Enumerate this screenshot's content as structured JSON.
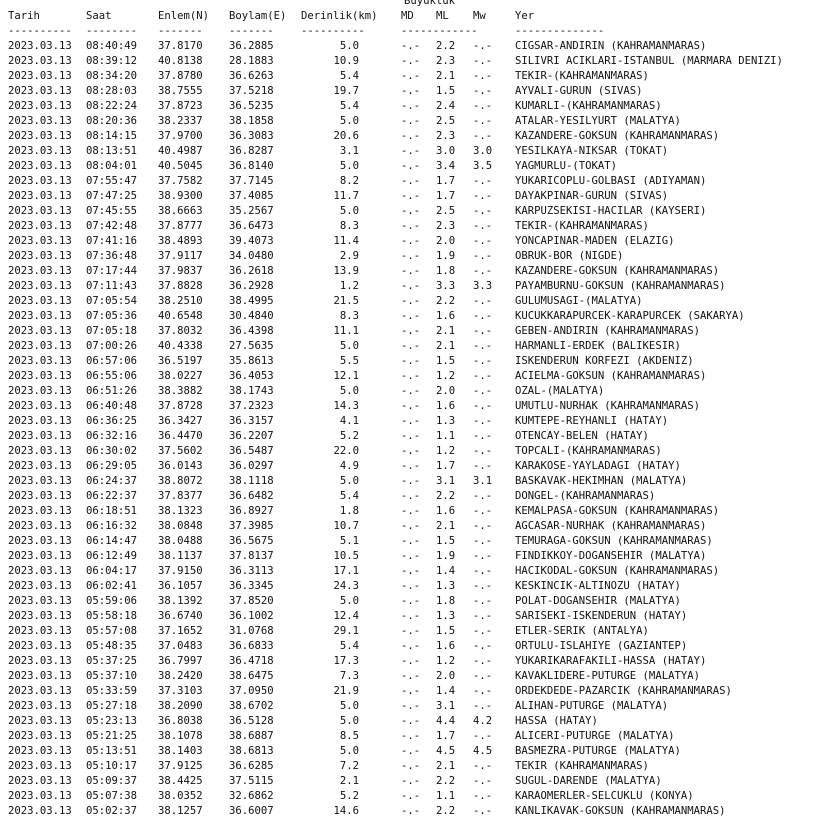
{
  "header": {
    "magnitude_group": "Buyukluk",
    "date": "Tarih",
    "time": "Saat",
    "lat": "Enlem(N)",
    "lon": "Boylam(E)",
    "depth": "Derinlik(km)",
    "md": "MD",
    "ml": "ML",
    "mw": "Mw",
    "place": "Yer"
  },
  "separators": {
    "date": "----------",
    "time": "--------",
    "lat": "-------",
    "lon": "-------",
    "depth": "----------",
    "mag": "------------",
    "place": "--------------"
  },
  "rows": [
    [
      "2023.03.13",
      "08:40:49",
      "37.8170",
      "36.2885",
      "5.0",
      "-.-",
      "2.2",
      "-.-",
      "CIGSAR-ANDIRIN (KAHRAMANMARAS)"
    ],
    [
      "2023.03.13",
      "08:39:12",
      "40.8138",
      "28.1883",
      "10.9",
      "-.-",
      "2.3",
      "-.-",
      "SILIVRI ACIKLARI-ISTANBUL (MARMARA DENIZI)"
    ],
    [
      "2023.03.13",
      "08:34:20",
      "37.8780",
      "36.6263",
      "5.4",
      "-.-",
      "2.1",
      "-.-",
      "TEKIR-(KAHRAMANMARAS)"
    ],
    [
      "2023.03.13",
      "08:28:03",
      "38.7555",
      "37.5218",
      "19.7",
      "-.-",
      "1.5",
      "-.-",
      "AYVALI-GURUN (SIVAS)"
    ],
    [
      "2023.03.13",
      "08:22:24",
      "37.8723",
      "36.5235",
      "5.4",
      "-.-",
      "2.4",
      "-.-",
      "KUMARLI-(KAHRAMANMARAS)"
    ],
    [
      "2023.03.13",
      "08:20:36",
      "38.2337",
      "38.1858",
      "5.0",
      "-.-",
      "2.5",
      "-.-",
      "ATALAR-YESILYURT (MALATYA)"
    ],
    [
      "2023.03.13",
      "08:14:15",
      "37.9700",
      "36.3083",
      "20.6",
      "-.-",
      "2.3",
      "-.-",
      "KAZANDERE-GOKSUN (KAHRAMANMARAS)"
    ],
    [
      "2023.03.13",
      "08:13:51",
      "40.4987",
      "36.8287",
      "3.1",
      "-.-",
      "3.0",
      "3.0",
      "YESILKAYA-NIKSAR (TOKAT)"
    ],
    [
      "2023.03.13",
      "08:04:01",
      "40.5045",
      "36.8140",
      "5.0",
      "-.-",
      "3.4",
      "3.5",
      "YAGMURLU-(TOKAT)"
    ],
    [
      "2023.03.13",
      "07:55:47",
      "37.7582",
      "37.7145",
      "8.2",
      "-.-",
      "1.7",
      "-.-",
      "YUKARICOPLU-GOLBASI (ADIYAMAN)"
    ],
    [
      "2023.03.13",
      "07:47:25",
      "38.9300",
      "37.4085",
      "11.7",
      "-.-",
      "1.7",
      "-.-",
      "DAYAKPINAR-GURUN (SIVAS)"
    ],
    [
      "2023.03.13",
      "07:45:55",
      "38.6663",
      "35.2567",
      "5.0",
      "-.-",
      "2.5",
      "-.-",
      "KARPUZSEKISI-HACILAR (KAYSERI)"
    ],
    [
      "2023.03.13",
      "07:42:48",
      "37.8777",
      "36.6473",
      "8.3",
      "-.-",
      "2.3",
      "-.-",
      "TEKIR-(KAHRAMANMARAS)"
    ],
    [
      "2023.03.13",
      "07:41:16",
      "38.4893",
      "39.4073",
      "11.4",
      "-.-",
      "2.0",
      "-.-",
      "YONCAPINAR-MADEN (ELAZIG)"
    ],
    [
      "2023.03.13",
      "07:36:48",
      "37.9117",
      "34.0480",
      "2.9",
      "-.-",
      "1.9",
      "-.-",
      "OBRUK-BOR (NIGDE)"
    ],
    [
      "2023.03.13",
      "07:17:44",
      "37.9837",
      "36.2618",
      "13.9",
      "-.-",
      "1.8",
      "-.-",
      "KAZANDERE-GOKSUN (KAHRAMANMARAS)"
    ],
    [
      "2023.03.13",
      "07:11:43",
      "37.8828",
      "36.2928",
      "1.2",
      "-.-",
      "3.3",
      "3.3",
      "PAYAMBURNU-GOKSUN (KAHRAMANMARAS)"
    ],
    [
      "2023.03.13",
      "07:05:54",
      "38.2510",
      "38.4995",
      "21.5",
      "-.-",
      "2.2",
      "-.-",
      "GULUMUSAGI-(MALATYA)"
    ],
    [
      "2023.03.13",
      "07:05:36",
      "40.6548",
      "30.4840",
      "8.3",
      "-.-",
      "1.6",
      "-.-",
      "KUCUKKARAPURCEK-KARAPURCEK (SAKARYA)"
    ],
    [
      "2023.03.13",
      "07:05:18",
      "37.8032",
      "36.4398",
      "11.1",
      "-.-",
      "2.1",
      "-.-",
      "GEBEN-ANDIRIN (KAHRAMANMARAS)"
    ],
    [
      "2023.03.13",
      "07:00:26",
      "40.4338",
      "27.5635",
      "5.0",
      "-.-",
      "2.1",
      "-.-",
      "HARMANLI-ERDEK (BALIKESIR)"
    ],
    [
      "2023.03.13",
      "06:57:06",
      "36.5197",
      "35.8613",
      "5.5",
      "-.-",
      "1.5",
      "-.-",
      "ISKENDERUN KORFEZI (AKDENIZ)"
    ],
    [
      "2023.03.13",
      "06:55:06",
      "38.0227",
      "36.4053",
      "12.1",
      "-.-",
      "1.2",
      "-.-",
      "ACIELMA-GOKSUN (KAHRAMANMARAS)"
    ],
    [
      "2023.03.13",
      "06:51:26",
      "38.3882",
      "38.1743",
      "5.0",
      "-.-",
      "2.0",
      "-.-",
      "OZAL-(MALATYA)"
    ],
    [
      "2023.03.13",
      "06:40:48",
      "37.8728",
      "37.2323",
      "14.3",
      "-.-",
      "1.6",
      "-.-",
      "UMUTLU-NURHAK (KAHRAMANMARAS)"
    ],
    [
      "2023.03.13",
      "06:36:25",
      "36.3427",
      "36.3157",
      "4.1",
      "-.-",
      "1.3",
      "-.-",
      "KUMTEPE-REYHANLI (HATAY)"
    ],
    [
      "2023.03.13",
      "06:32:16",
      "36.4470",
      "36.2207",
      "5.2",
      "-.-",
      "1.1",
      "-.-",
      "OTENCAY-BELEN (HATAY)"
    ],
    [
      "2023.03.13",
      "06:30:02",
      "37.5602",
      "36.5487",
      "22.0",
      "-.-",
      "1.2",
      "-.-",
      "TOPCALI-(KAHRAMANMARAS)"
    ],
    [
      "2023.03.13",
      "06:29:05",
      "36.0143",
      "36.0297",
      "4.9",
      "-.-",
      "1.7",
      "-.-",
      "KARAKOSE-YAYLADAGI (HATAY)"
    ],
    [
      "2023.03.13",
      "06:24:37",
      "38.8072",
      "38.1118",
      "5.0",
      "-.-",
      "3.1",
      "3.1",
      "BASKAVAK-HEKIMHAN (MALATYA)"
    ],
    [
      "2023.03.13",
      "06:22:37",
      "37.8377",
      "36.6482",
      "5.4",
      "-.-",
      "2.2",
      "-.-",
      "DONGEL-(KAHRAMANMARAS)"
    ],
    [
      "2023.03.13",
      "06:18:51",
      "38.1323",
      "36.8927",
      "1.8",
      "-.-",
      "1.6",
      "-.-",
      "KEMALPASA-GOKSUN (KAHRAMANMARAS)"
    ],
    [
      "2023.03.13",
      "06:16:32",
      "38.0848",
      "37.3985",
      "10.7",
      "-.-",
      "2.1",
      "-.-",
      "AGCASAR-NURHAK (KAHRAMANMARAS)"
    ],
    [
      "2023.03.13",
      "06:14:47",
      "38.0488",
      "36.5675",
      "5.1",
      "-.-",
      "1.5",
      "-.-",
      "TEMURAGA-GOKSUN (KAHRAMANMARAS)"
    ],
    [
      "2023.03.13",
      "06:12:49",
      "38.1137",
      "37.8137",
      "10.5",
      "-.-",
      "1.9",
      "-.-",
      "FINDIKKOY-DOGANSEHIR (MALATYA)"
    ],
    [
      "2023.03.13",
      "06:04:17",
      "37.9150",
      "36.3113",
      "17.1",
      "-.-",
      "1.4",
      "-.-",
      "HACIKODAL-GOKSUN (KAHRAMANMARAS)"
    ],
    [
      "2023.03.13",
      "06:02:41",
      "36.1057",
      "36.3345",
      "24.3",
      "-.-",
      "1.3",
      "-.-",
      "KESKINCIK-ALTINOZU (HATAY)"
    ],
    [
      "2023.03.13",
      "05:59:06",
      "38.1392",
      "37.8520",
      "5.0",
      "-.-",
      "1.8",
      "-.-",
      "POLAT-DOGANSEHIR (MALATYA)"
    ],
    [
      "2023.03.13",
      "05:58:18",
      "36.6740",
      "36.1002",
      "12.4",
      "-.-",
      "1.3",
      "-.-",
      "SARISEKI-ISKENDERUN (HATAY)"
    ],
    [
      "2023.03.13",
      "05:57:08",
      "37.1652",
      "31.0768",
      "29.1",
      "-.-",
      "1.5",
      "-.-",
      "ETLER-SERIK (ANTALYA)"
    ],
    [
      "2023.03.13",
      "05:48:35",
      "37.0483",
      "36.6833",
      "5.4",
      "-.-",
      "1.6",
      "-.-",
      "ORTULU-ISLAHIYE (GAZIANTEP)"
    ],
    [
      "2023.03.13",
      "05:37:25",
      "36.7997",
      "36.4718",
      "17.3",
      "-.-",
      "1.2",
      "-.-",
      "YUKARIKARAFAKILI-HASSA (HATAY)"
    ],
    [
      "2023.03.13",
      "05:37:10",
      "38.2420",
      "38.6475",
      "7.3",
      "-.-",
      "2.0",
      "-.-",
      "KAVAKLIDERE-PUTURGE (MALATYA)"
    ],
    [
      "2023.03.13",
      "05:33:59",
      "37.3103",
      "37.0950",
      "21.9",
      "-.-",
      "1.4",
      "-.-",
      "ORDEKDEDE-PAZARCIK (KAHRAMANMARAS)"
    ],
    [
      "2023.03.13",
      "05:27:18",
      "38.2090",
      "38.6702",
      "5.0",
      "-.-",
      "3.1",
      "-.-",
      "ALIHAN-PUTURGE (MALATYA)"
    ],
    [
      "2023.03.13",
      "05:23:13",
      "36.8038",
      "36.5128",
      "5.0",
      "-.-",
      "4.4",
      "4.2",
      "HASSA (HATAY)"
    ],
    [
      "2023.03.13",
      "05:21:25",
      "38.1078",
      "38.6887",
      "8.5",
      "-.-",
      "1.7",
      "-.-",
      "ALICERI-PUTURGE (MALATYA)"
    ],
    [
      "2023.03.13",
      "05:13:51",
      "38.1403",
      "38.6813",
      "5.0",
      "-.-",
      "4.5",
      "4.5",
      "BASMEZRA-PUTURGE (MALATYA)"
    ],
    [
      "2023.03.13",
      "05:10:17",
      "37.9125",
      "36.6285",
      "7.2",
      "-.-",
      "2.1",
      "-.-",
      "TEKIR (KAHRAMANMARAS)"
    ],
    [
      "2023.03.13",
      "05:09:37",
      "38.4425",
      "37.5115",
      "2.1",
      "-.-",
      "2.2",
      "-.-",
      "SUGUL-DARENDE (MALATYA)"
    ],
    [
      "2023.03.13",
      "05:07:38",
      "38.0352",
      "32.6862",
      "5.2",
      "-.-",
      "1.1",
      "-.-",
      "KARAOMERLER-SELCUKLU (KONYA)"
    ],
    [
      "2023.03.13",
      "05:02:37",
      "38.1257",
      "36.6007",
      "14.6",
      "-.-",
      "2.2",
      "-.-",
      "KANLIKAVAK-GOKSUN (KAHRAMANMARAS)"
    ]
  ]
}
